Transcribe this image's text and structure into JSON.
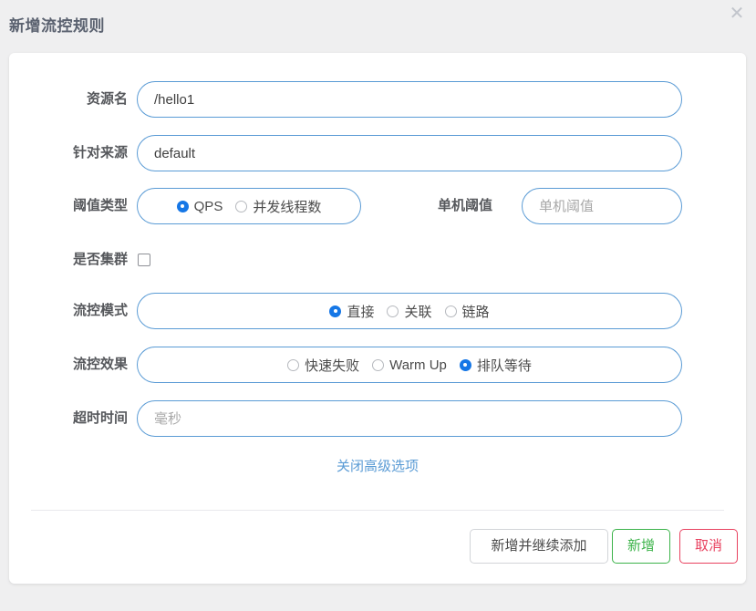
{
  "dialog": {
    "title": "新增流控规则",
    "close_icon": "close-icon",
    "close_glyph": "✕"
  },
  "form": {
    "rows": [
      {
        "label": "资源名",
        "value": "/hello1",
        "placeholder": "资源名"
      },
      {
        "label": "针对来源",
        "value": "default",
        "placeholder": "针对来源"
      }
    ],
    "threshold_type": {
      "label": "阈值类型",
      "options": [
        {
          "label": "QPS",
          "selected": true
        },
        {
          "label": "并发线程数",
          "selected": false
        }
      ]
    },
    "single_threshold": {
      "label": "单机阈值",
      "value": "",
      "placeholder": "单机阈值"
    },
    "cluster": {
      "label": "是否集群",
      "checked": false
    },
    "flow_mode": {
      "label": "流控模式",
      "options": [
        {
          "label": "直接",
          "selected": true
        },
        {
          "label": "关联",
          "selected": false
        },
        {
          "label": "链路",
          "selected": false
        }
      ]
    },
    "flow_effect": {
      "label": "流控效果",
      "options": [
        {
          "label": "快速失败",
          "selected": false
        },
        {
          "label": "Warm Up",
          "selected": false
        },
        {
          "label": "排队等待",
          "selected": true
        }
      ]
    },
    "timeout": {
      "label": "超时时间",
      "value": "",
      "placeholder": "毫秒"
    },
    "advanced_link": "关闭高级选项"
  },
  "footer": {
    "add_continue_label": "新增并继续添加",
    "add_label": "新增",
    "cancel_label": "取消"
  },
  "colors": {
    "page_background": "#efeff0",
    "card_background": "#ffffff",
    "title_text": "#5b6270",
    "label_text": "#56585c",
    "field_border": "#5a9bd5",
    "link": "#5a9bd5",
    "radio_selected": "#1677e6",
    "success": "#3cb34a",
    "danger": "#e8415f",
    "default_border": "#d2d4d8"
  }
}
